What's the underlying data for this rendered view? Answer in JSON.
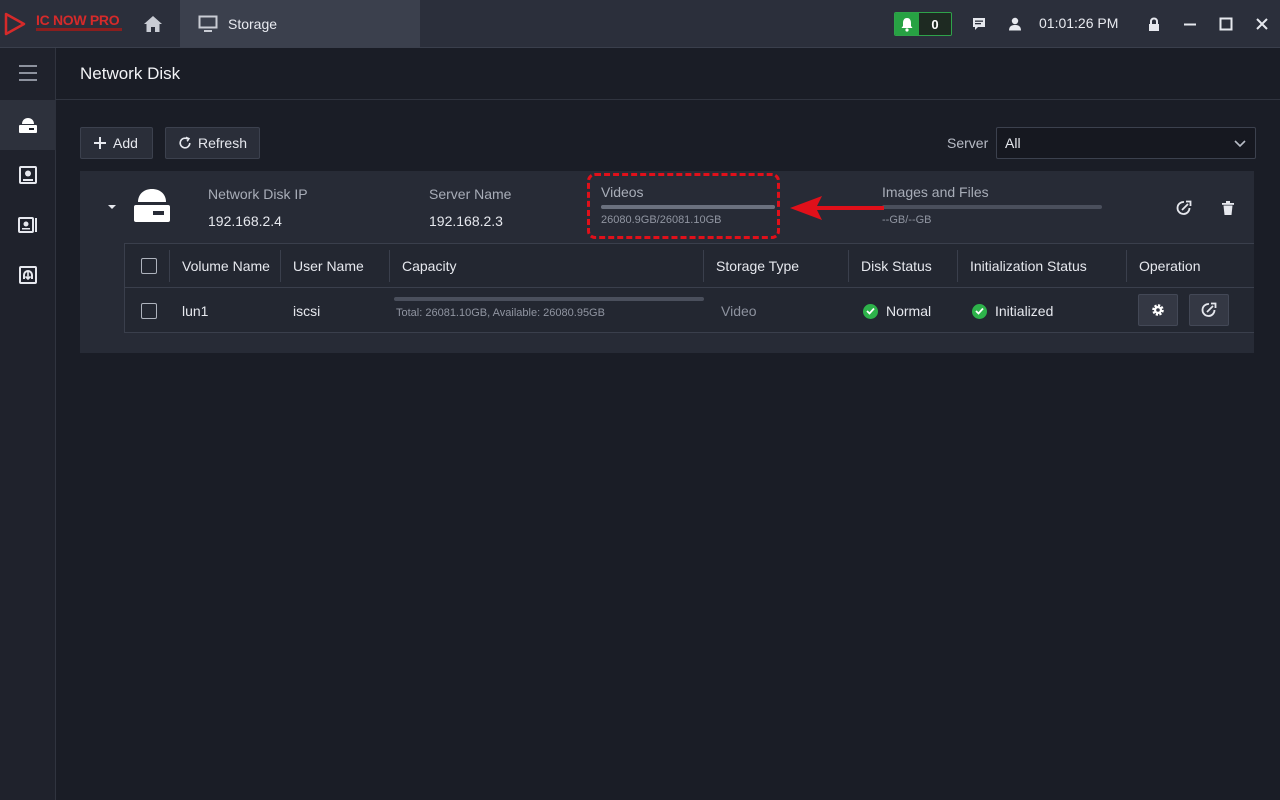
{
  "app": {
    "logo_text": "IC NOW PRO",
    "tab_label": "Storage",
    "notification_count": "0",
    "clock": "01:01:26 PM"
  },
  "page": {
    "title": "Network Disk"
  },
  "toolbar": {
    "add_label": "Add",
    "refresh_label": "Refresh",
    "server_label": "Server",
    "server_value": "All"
  },
  "disk": {
    "ip_label": "Network Disk IP",
    "ip_value": "192.168.2.4",
    "server_name_label": "Server Name",
    "server_name_value": "192.168.2.3",
    "videos_label": "Videos",
    "videos_usage": "26080.9GB/26081.10GB",
    "videos_used_fraction": 0.99999,
    "images_label": "Images and Files",
    "images_usage": "--GB/--GB"
  },
  "table": {
    "headers": [
      "Volume Name",
      "User Name",
      "Capacity",
      "Storage Type",
      "Disk Status",
      "Initialization Status",
      "Operation"
    ],
    "rows": [
      {
        "volume": "lun1",
        "user": "iscsi",
        "capacity_text": "Total: 26081.10GB,  Available: 26080.95GB",
        "storage_type": "Video",
        "disk_status": "Normal",
        "init_status": "Initialized"
      }
    ]
  },
  "colors": {
    "accent_red": "#e0101a",
    "ok_green": "#2db24a",
    "notif_green": "#27a243"
  }
}
